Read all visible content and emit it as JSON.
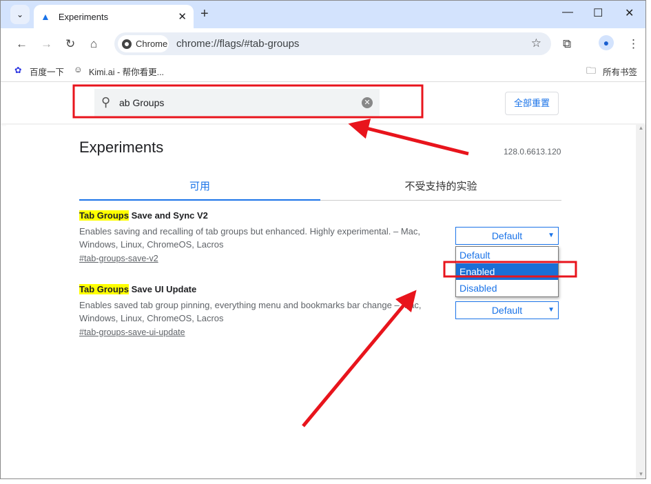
{
  "browser": {
    "tab_title": "Experiments",
    "new_tab": "+",
    "chip": "Chrome",
    "url": "chrome://flags/#tab-groups",
    "bookmarks": [
      {
        "label": "百度一下"
      },
      {
        "label": "Kimi.ai - 帮你看更..."
      }
    ],
    "all_bookmarks": "所有书签"
  },
  "header": {
    "search_value": "ab Groups",
    "reset_label": "全部重置"
  },
  "main": {
    "title": "Experiments",
    "version": "128.0.6613.120",
    "tabs": [
      {
        "label": "可用",
        "active": true
      },
      {
        "label": "不受支持的实验",
        "active": false
      }
    ],
    "experiments": [
      {
        "title_highlight": "Tab Groups",
        "title_rest": " Save and Sync V2",
        "description": "Enables saving and recalling of tab groups but enhanced. Highly experimental. – Mac, Windows, Linux, ChromeOS, Lacros",
        "link": "#tab-groups-save-v2",
        "value": "Default"
      },
      {
        "title_highlight": "Tab Groups",
        "title_rest": " Save UI Update",
        "description": "Enables saved tab group pinning, everything menu and bookmarks bar change – Mac, Windows, Linux, ChromeOS, Lacros",
        "link": "#tab-groups-save-ui-update",
        "value": "Default"
      }
    ],
    "dropdown_options": [
      "Default",
      "Enabled",
      "Disabled"
    ],
    "dropdown_highlighted": "Enabled"
  },
  "colors": {
    "accent": "#1a73e8",
    "highlight": "#ffff00",
    "annotation": "#e8141c",
    "tabstrip": "#d3e3fd"
  }
}
